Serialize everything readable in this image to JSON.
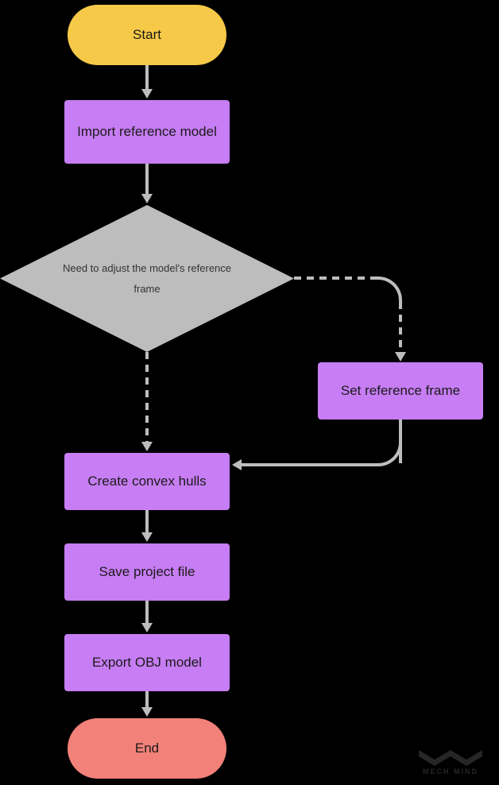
{
  "flow": {
    "start": "Start",
    "import_model": "Import reference model",
    "decision": "Need to adjust the model's reference frame",
    "set_frame": "Set reference frame",
    "create_hulls": "Create convex hulls",
    "save_project": "Save project file",
    "export_obj": "Export OBJ model",
    "end": "End"
  },
  "watermark": "MECH MIND"
}
